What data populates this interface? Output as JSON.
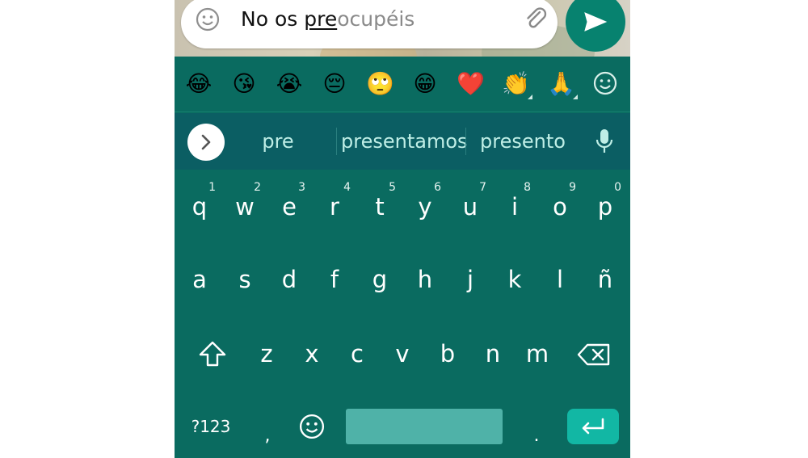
{
  "input": {
    "typed_text": "No os ",
    "composing_text": "pre",
    "autocomplete_ghost": "ocupéis"
  },
  "emoji_bar": {
    "emojis": [
      "😂",
      "😘",
      "😭",
      "😔",
      "🙄",
      "😁",
      "❤️",
      "👏",
      "🙏"
    ]
  },
  "suggestions": [
    "pre",
    "presentamos",
    "presento"
  ],
  "keyboard": {
    "row1": [
      {
        "label": "q",
        "hint": "1"
      },
      {
        "label": "w",
        "hint": "2"
      },
      {
        "label": "e",
        "hint": "3"
      },
      {
        "label": "r",
        "hint": "4"
      },
      {
        "label": "t",
        "hint": "5"
      },
      {
        "label": "y",
        "hint": "6"
      },
      {
        "label": "u",
        "hint": "7"
      },
      {
        "label": "i",
        "hint": "8"
      },
      {
        "label": "o",
        "hint": "9"
      },
      {
        "label": "p",
        "hint": "0"
      }
    ],
    "row2": [
      "a",
      "s",
      "d",
      "f",
      "g",
      "h",
      "j",
      "k",
      "l",
      "ñ"
    ],
    "row3": [
      "z",
      "x",
      "c",
      "v",
      "b",
      "n",
      "m"
    ],
    "symbols_key": "?123",
    "comma_key": ",",
    "period_key": "."
  },
  "icons": {
    "smiley": "smiley-icon",
    "attach": "paperclip-icon",
    "send": "send-icon",
    "expand": "chevron-right-icon",
    "mic": "microphone-icon",
    "shift": "shift-icon",
    "backspace": "backspace-icon",
    "enter": "enter-icon",
    "emoji_keyboard": "emoji-keyboard-icon"
  },
  "colors": {
    "keyboard_bg": "#0a6b60",
    "suggestion_bg": "#0b5e63",
    "send_button": "#07826f",
    "enter_key": "#12b7a4",
    "space_bar": "#4fb2a8"
  }
}
